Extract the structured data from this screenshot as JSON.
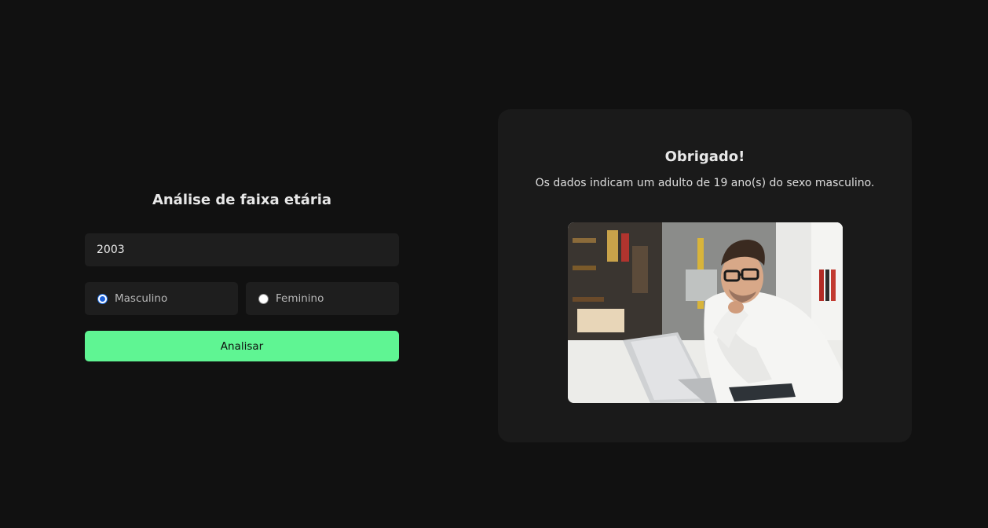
{
  "form": {
    "title": "Análise de faixa etária",
    "year_value": "2003",
    "gender_options": [
      {
        "label": "Masculino",
        "checked": true
      },
      {
        "label": "Feminino",
        "checked": false
      }
    ],
    "submit_label": "Analisar"
  },
  "result": {
    "title": "Obrigado!",
    "message": "Os dados indicam um adulto de 19 ano(s) do sexo masculino.",
    "photo_subject": "young man with glasses at laptop"
  },
  "colors": {
    "background": "#111111",
    "card": "#1a1a1a",
    "accent": "#5ff593",
    "radio_checked": "#1a5fd8"
  }
}
